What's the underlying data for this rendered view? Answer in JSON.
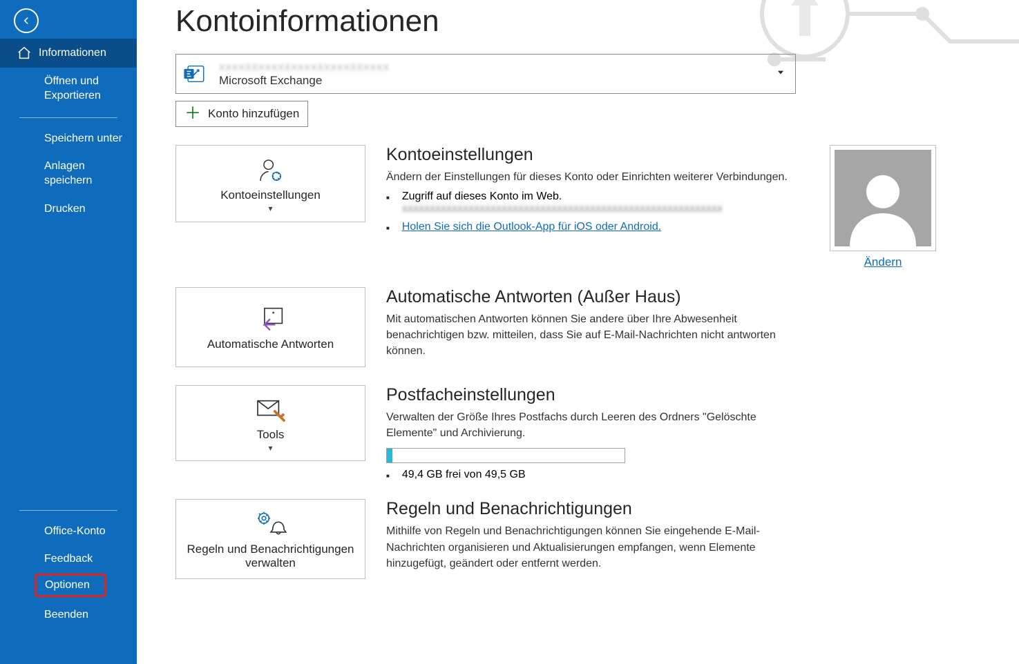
{
  "sidebar": {
    "items": [
      {
        "label": "Informationen"
      },
      {
        "label": "Öffnen und Exportieren"
      },
      {
        "label": "Speichern unter"
      },
      {
        "label": "Anlagen speichern"
      },
      {
        "label": "Drucken"
      }
    ],
    "bottom": [
      {
        "label": "Office-Konto"
      },
      {
        "label": "Feedback"
      },
      {
        "label": "Optionen"
      },
      {
        "label": "Beenden"
      }
    ]
  },
  "page": {
    "title": "Kontoinformationen"
  },
  "account": {
    "type": "Microsoft Exchange",
    "add_label": "Konto hinzufügen"
  },
  "cards": {
    "settings": "Kontoeinstellungen",
    "auto_reply": "Automatische Antworten",
    "tools": "Tools",
    "rules": "Regeln und Benachrichtigungen verwalten"
  },
  "sections": {
    "settings": {
      "title": "Kontoeinstellungen",
      "desc": "Ändern der Einstellungen für dieses Konto oder Einrichten weiterer Verbindungen.",
      "bullet1": "Zugriff auf dieses Konto im Web.",
      "bullet2_link": "Holen Sie sich die Outlook-App für iOS oder Android.",
      "change_link": "Ändern"
    },
    "auto_reply": {
      "title": "Automatische Antworten (Außer Haus)",
      "desc": "Mit automatischen Antworten können Sie andere über Ihre Abwesenheit benachrichtigen bzw. mitteilen, dass Sie auf E-Mail-Nachrichten nicht antworten können."
    },
    "mailbox": {
      "title": "Postfacheinstellungen",
      "desc": "Verwalten der Größe Ihres Postfachs durch Leeren des Ordners \"Gelöschte Elemente\" und Archivierung.",
      "storage": "49,4 GB frei von 49,5 GB"
    },
    "rules": {
      "title": "Regeln und Benachrichtigungen",
      "desc": "Mithilfe von Regeln und Benachrichtigungen können Sie eingehende E-Mail-Nachrichten organisieren und Aktualisierungen empfangen, wenn Elemente hinzugefügt, geändert oder entfernt werden."
    }
  }
}
